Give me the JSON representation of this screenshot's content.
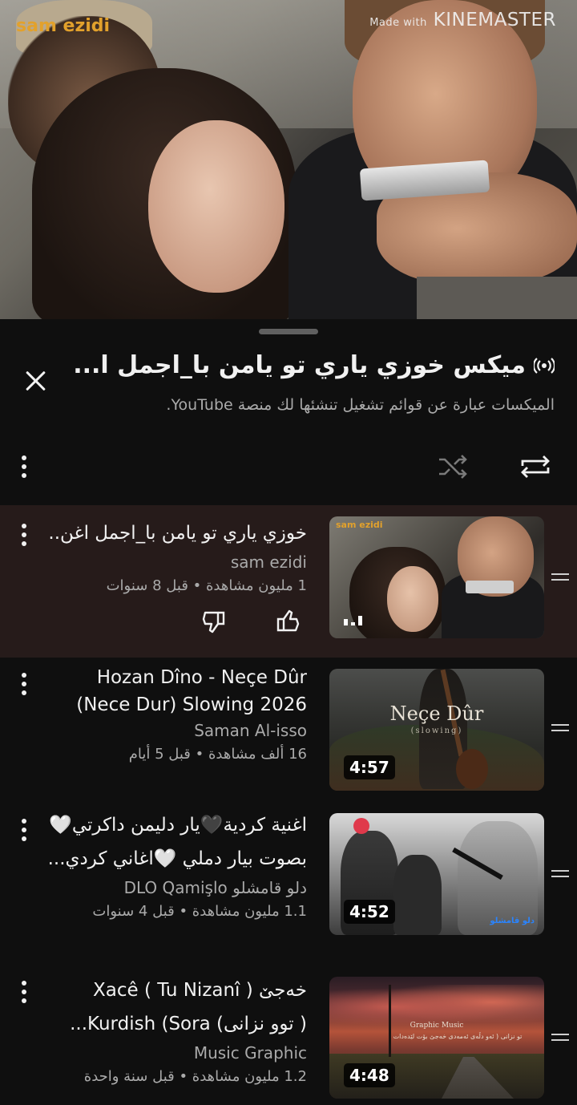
{
  "player": {
    "watermark_left": "sam ezidi",
    "watermark_right_prefix": "Made with",
    "watermark_right": "KINEMASTER"
  },
  "panel": {
    "title": "ميكس خوزي ياري تو يامن با_اجمل ا...",
    "subtitle": "الميكسات عبارة عن قوائم تشغيل تنشئها لك منصة YouTube.",
    "icons": {
      "mix": "mix-radio-icon",
      "close": "close-icon",
      "menu": "more-vert-icon",
      "shuffle": "shuffle-icon",
      "repeat": "repeat-icon"
    }
  },
  "items": [
    {
      "title_lines": [
        "خوزي ياري تو يامن با_اجمل اغن.."
      ],
      "channel": "sam ezidi",
      "meta": "1 مليون مشاهدة • قبل 8 سنوات",
      "duration": "",
      "active": true,
      "thumb_watermark": "sam ezidi"
    },
    {
      "title_lines": [
        "Hozan Dîno - Neçe Dûr",
        "(Nece Dur) Slowing 2026"
      ],
      "channel": "Saman Al-isso",
      "meta": "16 ألف مشاهدة • قبل 5 أيام",
      "duration": "4:57",
      "active": false,
      "thumb_caption": "Neçe Dûr",
      "thumb_subcaption": "(slowing)"
    },
    {
      "title_lines": [
        "اغنية كردية🖤يار دليمن داكرتي🤍",
        "بصوت بيار دملي 🤍اغاني كردي..."
      ],
      "channel": "دلو قامشلو DLO Qamişlo",
      "meta": "1.1 مليون مشاهدة • قبل 4 سنوات",
      "duration": "4:52",
      "active": false,
      "thumb_logo": "دلو قامشلو"
    },
    {
      "title_lines": [
        "خەجێ ( Xacê ( Tu Nizanî",
        "( توو نزانى) Kurdish (Sora..."
      ],
      "channel": "Music Graphic",
      "meta": "1.2 مليون مشاهدة • قبل سنة واحدة",
      "duration": "4:48",
      "active": false,
      "thumb_line1": "Graphic Music",
      "thumb_line2": "تو نزانی ( ئەو دڵەی ئەمەدی خەجێ بۆت لێدەدات"
    }
  ]
}
